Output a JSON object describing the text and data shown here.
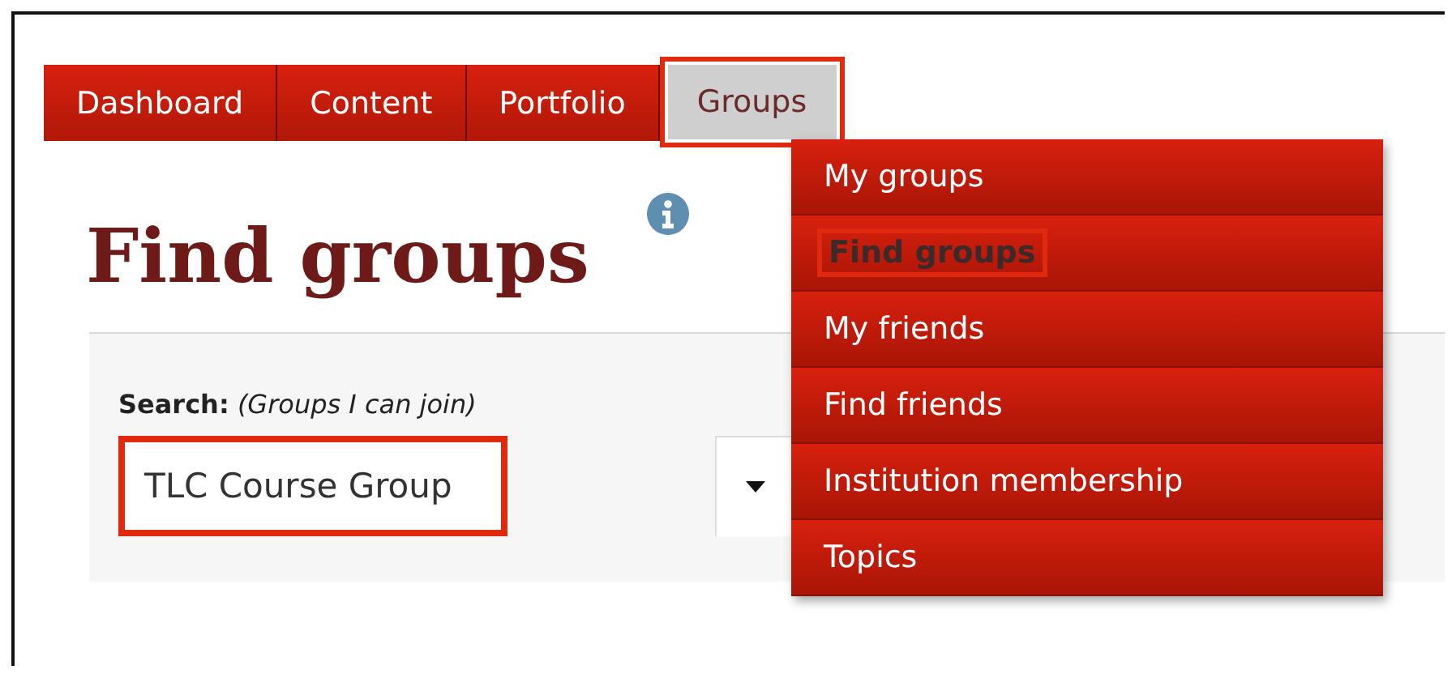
{
  "nav": {
    "tabs": [
      {
        "label": "Dashboard",
        "selected": false,
        "annotated": false
      },
      {
        "label": "Content",
        "selected": false,
        "annotated": false
      },
      {
        "label": "Portfolio",
        "selected": false,
        "annotated": false
      },
      {
        "label": "Groups",
        "selected": true,
        "annotated": true
      }
    ]
  },
  "dropdown": {
    "items": [
      {
        "label": "My groups",
        "selected": false,
        "annotated": false
      },
      {
        "label": "Find groups",
        "selected": true,
        "annotated": true
      },
      {
        "label": "My friends",
        "selected": false,
        "annotated": false
      },
      {
        "label": "Find friends",
        "selected": false,
        "annotated": false
      },
      {
        "label": "Institution membership",
        "selected": false,
        "annotated": false
      },
      {
        "label": "Topics",
        "selected": false,
        "annotated": false
      }
    ]
  },
  "heading": "Find groups",
  "search": {
    "label": "Search:",
    "hint": "(Groups I can join)",
    "value": "TLC Course Group",
    "annotated": true
  }
}
